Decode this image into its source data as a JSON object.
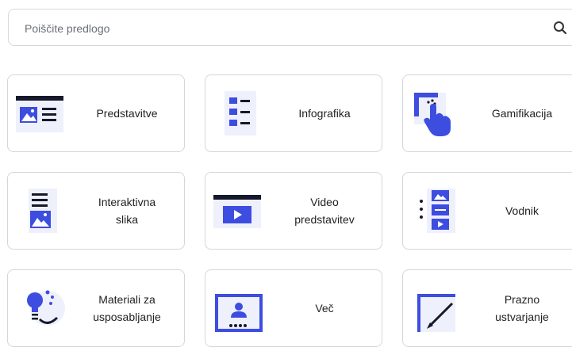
{
  "search": {
    "placeholder": "Poiščite predlogo"
  },
  "cards": [
    {
      "label": "Predstavitve",
      "icon": "presentation-icon"
    },
    {
      "label": "Infografika",
      "icon": "infographic-icon"
    },
    {
      "label": "Gamifikacija",
      "icon": "gamification-icon"
    },
    {
      "label": "Interaktivna\nslika",
      "icon": "interactive-image-icon"
    },
    {
      "label": "Video\npredstavitev",
      "icon": "video-presentation-icon"
    },
    {
      "label": "Vodnik",
      "icon": "guide-icon"
    },
    {
      "label": "Materiali za\nusposabljanje",
      "icon": "training-materials-icon"
    },
    {
      "label": "Več",
      "icon": "more-icon"
    },
    {
      "label": "Prazno\nustvarjanje",
      "icon": "blank-create-icon"
    }
  ],
  "colors": {
    "accent": "#3d4de0",
    "dark": "#15192b"
  }
}
